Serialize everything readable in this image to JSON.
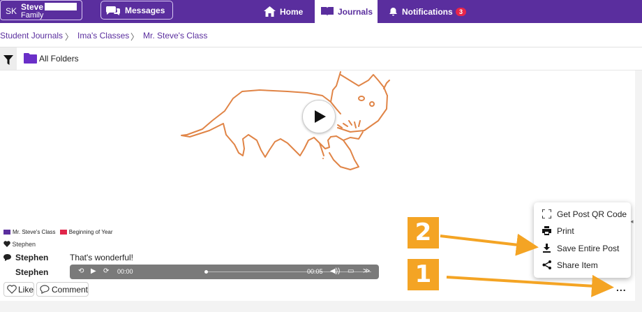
{
  "header": {
    "user": {
      "initials": "SK",
      "name": "Steve",
      "role": "Family"
    },
    "messages_label": "Messages",
    "nav": [
      {
        "label": "Home",
        "icon": "home-icon"
      },
      {
        "label": "Journals",
        "icon": "book-icon"
      },
      {
        "label": "Notifications",
        "icon": "bell-icon",
        "badge": "3"
      }
    ]
  },
  "breadcrumb": [
    "Student Journals",
    "Ima's Classes",
    "Mr. Steve's Class"
  ],
  "breadcrumb_separator": "〉",
  "folder_bar": {
    "label": "All Folders"
  },
  "post": {
    "folders": [
      {
        "label": "Mr. Steve's Class",
        "color": "#5a2e9e"
      },
      {
        "label": "Beginning of Year",
        "color": "#e0264a"
      }
    ],
    "liked_by": "Stephen",
    "comments": [
      {
        "author": "Stephen",
        "text": "That's wonderful!"
      },
      {
        "author": "Stephen",
        "type": "audio"
      }
    ],
    "audio": {
      "current_time": "00:00",
      "duration": "00:05"
    },
    "like_label": "Like",
    "comment_label": "Comment",
    "more_label": "..."
  },
  "menu": {
    "items": [
      {
        "label": "Get Post QR Code",
        "icon": "qr-scan-icon"
      },
      {
        "label": "Print",
        "icon": "print-icon"
      },
      {
        "label": "Save Entire Post",
        "icon": "download-icon"
      },
      {
        "label": "Share Item",
        "icon": "share-icon"
      }
    ]
  },
  "callouts": [
    "1",
    "2"
  ],
  "colors": {
    "brand": "#5a2e9e",
    "accent_orange": "#f4a424",
    "badge_red": "#e8264a",
    "drawing_stroke": "#e08446"
  }
}
